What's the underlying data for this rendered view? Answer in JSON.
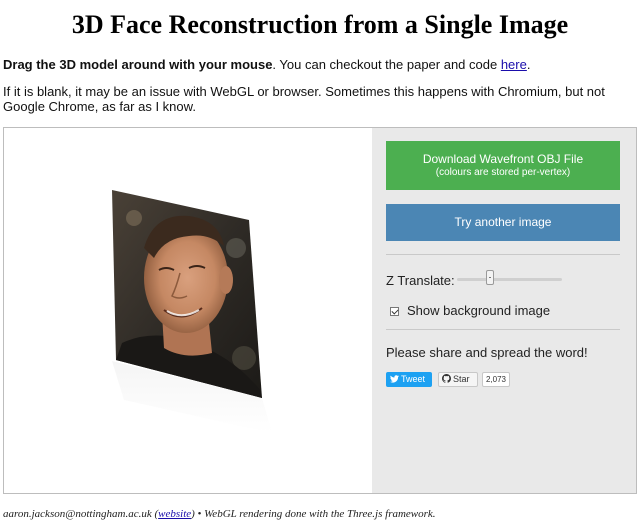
{
  "page": {
    "title": "3D Face Reconstruction from a Single Image"
  },
  "intro": {
    "bold": "Drag the 3D model around with your mouse",
    "text": ". You can checkout the paper and code ",
    "link": "here",
    "end": "."
  },
  "note": "If it is blank, it may be an issue with WebGL or browser. Sometimes this happens with Chromium, but not Google Chrome, as far as I know.",
  "panel": {
    "download_label": "Download Wavefront OBJ File",
    "download_sub": "(colours are stored per-vertex)",
    "try_label": "Try another image",
    "z_translate_label": "Z Translate:",
    "z_translate_value": 0.3,
    "show_bg_label": "Show background image",
    "show_bg_checked": true,
    "share_text": "Please share and spread the word!",
    "tweet_label": "Tweet",
    "star_label": "Star",
    "star_count": "2,073"
  },
  "footer": {
    "email": "aaron.jackson@nottingham.ac.uk (",
    "website_link": "website",
    "rest": ") • WebGL rendering done with the Three.js framework."
  },
  "colors": {
    "download": "#4caf50",
    "try": "#4b86b4",
    "panel_bg": "#e9e9e9",
    "twitter": "#1da1f2"
  }
}
